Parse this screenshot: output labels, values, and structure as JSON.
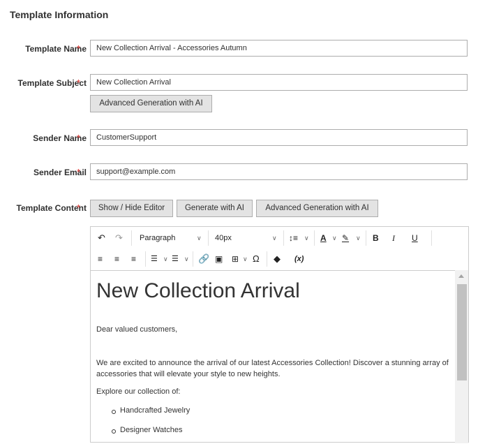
{
  "section_title": "Template Information",
  "required_marker": "*",
  "fields": {
    "template_name": {
      "label": "Template Name",
      "value": "New Collection Arrival - Accessories Autumn"
    },
    "template_subject": {
      "label": "Template Subject",
      "value": "New Collection Arrival"
    },
    "sender_name": {
      "label": "Sender Name",
      "value": "CustomerSupport"
    },
    "sender_email": {
      "label": "Sender Email",
      "value": "support@example.com"
    },
    "template_content": {
      "label": "Template Content"
    }
  },
  "buttons": {
    "subject_ai": "Advanced Generation with AI",
    "show_hide_editor": "Show / Hide Editor",
    "generate_ai": "Generate with AI",
    "advanced_ai": "Advanced Generation with AI"
  },
  "toolbar": {
    "block_format": "Paragraph",
    "font_size": "40px",
    "bold": "B",
    "italic": "I",
    "underline": "U",
    "variable": "(x)"
  },
  "editor_content": {
    "heading": "New Collection Arrival",
    "greeting": "Dear valued customers,",
    "intro": "We are excited to announce the arrival of our latest Accessories Collection! Discover a stunning array of accessories that will elevate your style to new heights.",
    "explore": "Explore our collection of:",
    "items": [
      "Handcrafted Jewelry",
      "Designer Watches"
    ]
  },
  "colors": {
    "required": "#e02b27",
    "button_bg": "#e3e3e3"
  }
}
